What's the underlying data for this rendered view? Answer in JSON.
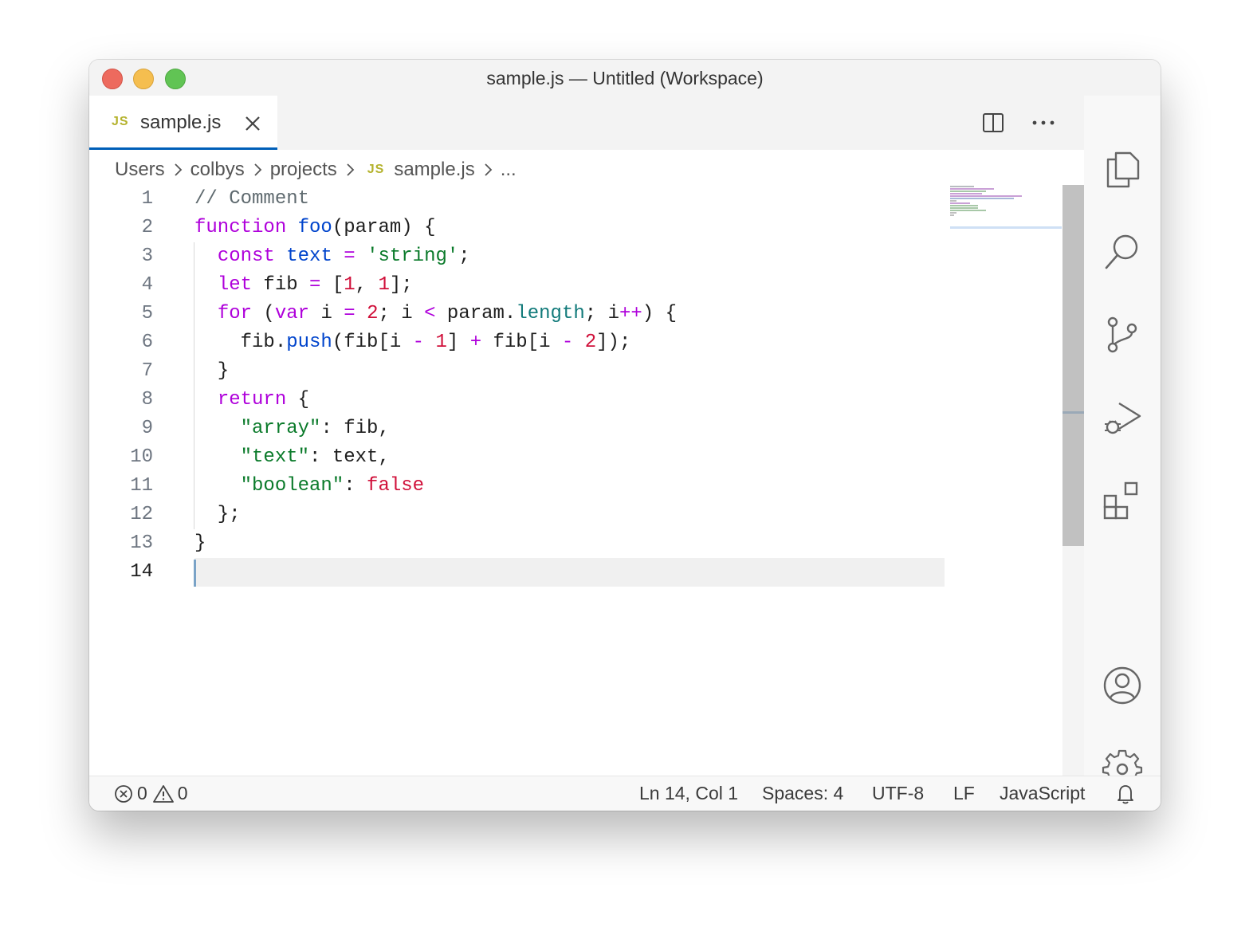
{
  "window": {
    "title": "sample.js — Untitled (Workspace)"
  },
  "tab": {
    "label": "sample.js",
    "badge": "JS"
  },
  "breadcrumb": {
    "items": [
      "Users",
      "colbys",
      "projects"
    ],
    "file": "sample.js",
    "badge": "JS",
    "more": "..."
  },
  "code": {
    "line_numbers": [
      "1",
      "2",
      "3",
      "4",
      "5",
      "6",
      "7",
      "8",
      "9",
      "10",
      "11",
      "12",
      "13",
      "14"
    ],
    "current_line": 14
  },
  "status": {
    "errors": "0",
    "warnings": "0",
    "position": "Ln 14, Col 1",
    "spaces": "Spaces: 4",
    "encoding": "UTF-8",
    "eol": "LF",
    "language": "JavaScript"
  },
  "icons": {
    "activity": [
      "explorer-icon",
      "search-icon",
      "source-control-icon",
      "run-debug-icon",
      "extensions-icon",
      "account-icon",
      "settings-gear-icon"
    ],
    "editor_actions": [
      "split-editor-icon",
      "more-actions-icon"
    ]
  },
  "colors": {
    "keyword": "#af00db",
    "function": "#0044cc",
    "string": "#0a7a2a",
    "number": "#d0103a",
    "comment": "#5f6a6f",
    "accent": "#005fb8"
  }
}
